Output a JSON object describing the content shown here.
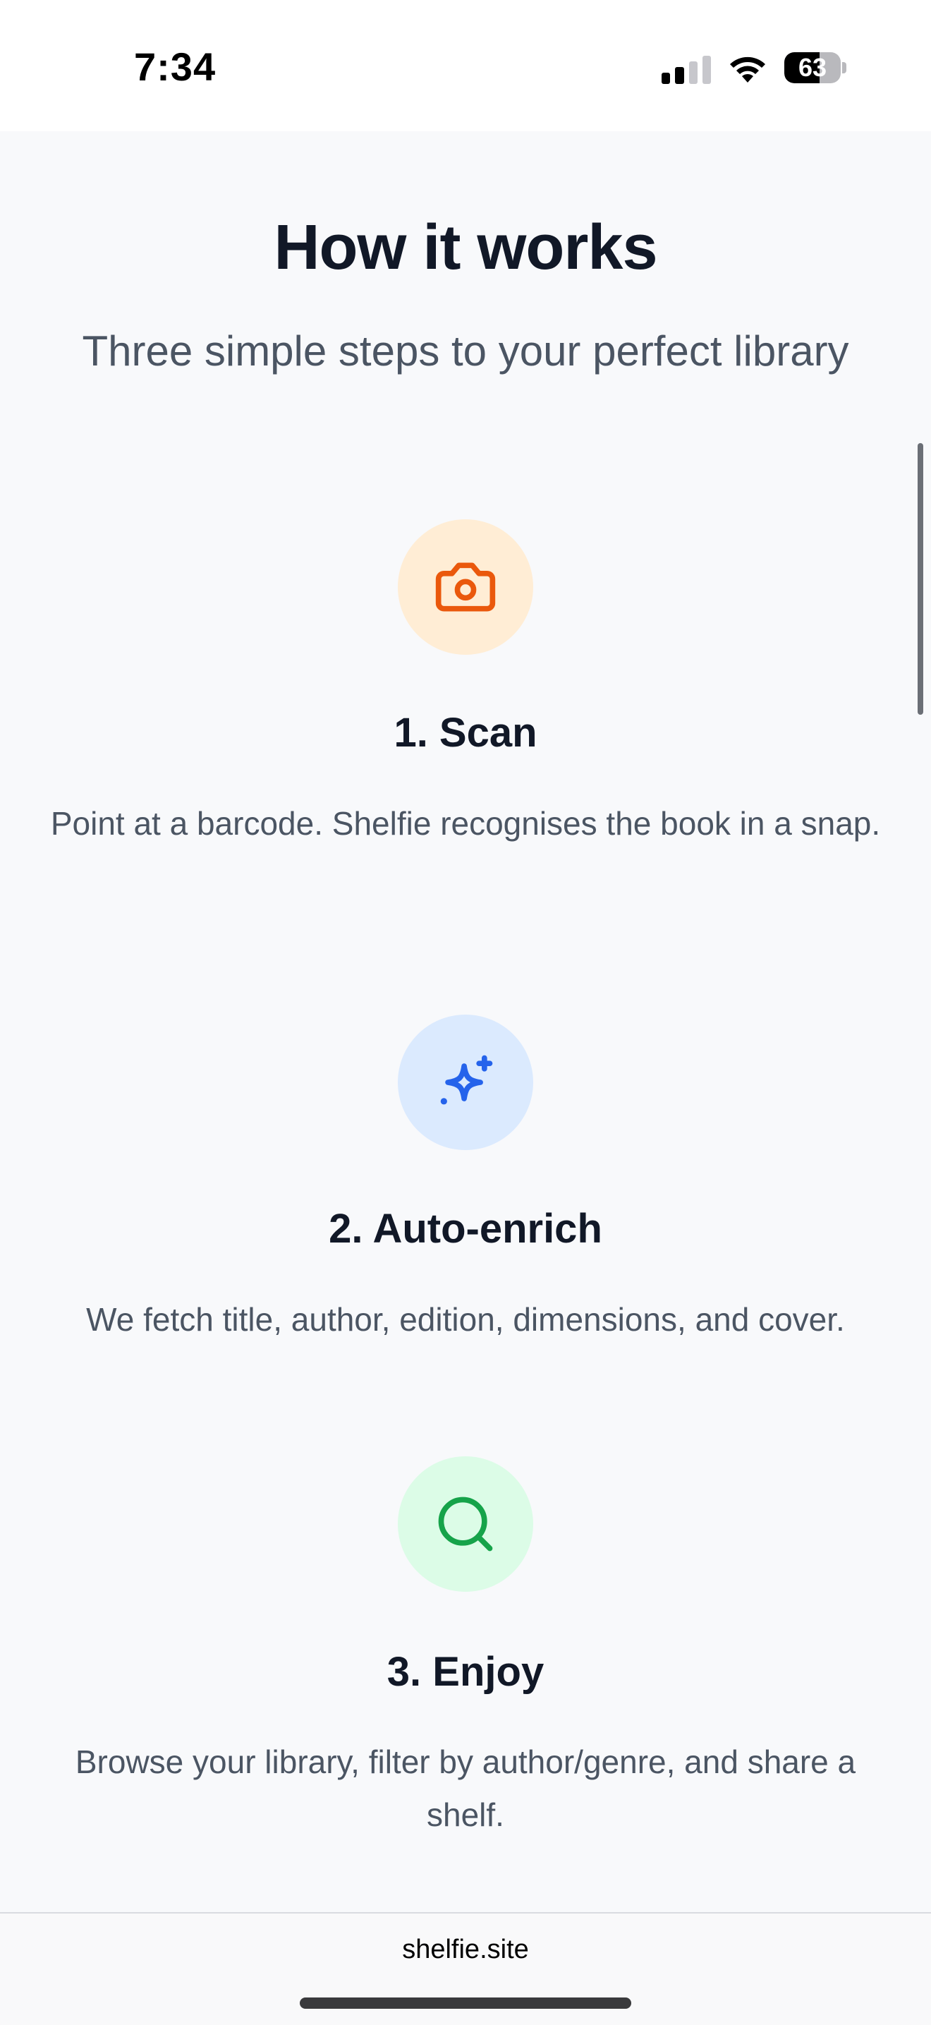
{
  "status_bar": {
    "time": "7:34",
    "battery": "63",
    "battery_level": 0.63,
    "signal_bars_active": 2,
    "signal_bars_total": 4
  },
  "main": {
    "title": "How it works",
    "subtitle": "Three simple steps to your perfect library",
    "steps": [
      {
        "title": "1. Scan",
        "description": "Point at a barcode. Shelfie recognises the book in a snap.",
        "icon": "camera-icon",
        "icon_color": "#ea580c",
        "icon_bg": "#ffedd5"
      },
      {
        "title": "2. Auto-enrich",
        "description": "We fetch title, author, edition, dimensions, and cover.",
        "icon": "sparkles-icon",
        "icon_color": "#2563eb",
        "icon_bg": "#dbeafe"
      },
      {
        "title": "3. Enjoy",
        "description": "Browse your library, filter by author/genre, and share a shelf.",
        "icon": "search-icon",
        "icon_color": "#16a34a",
        "icon_bg": "#dcfce7"
      }
    ]
  },
  "browser": {
    "url": "shelfie.site"
  }
}
